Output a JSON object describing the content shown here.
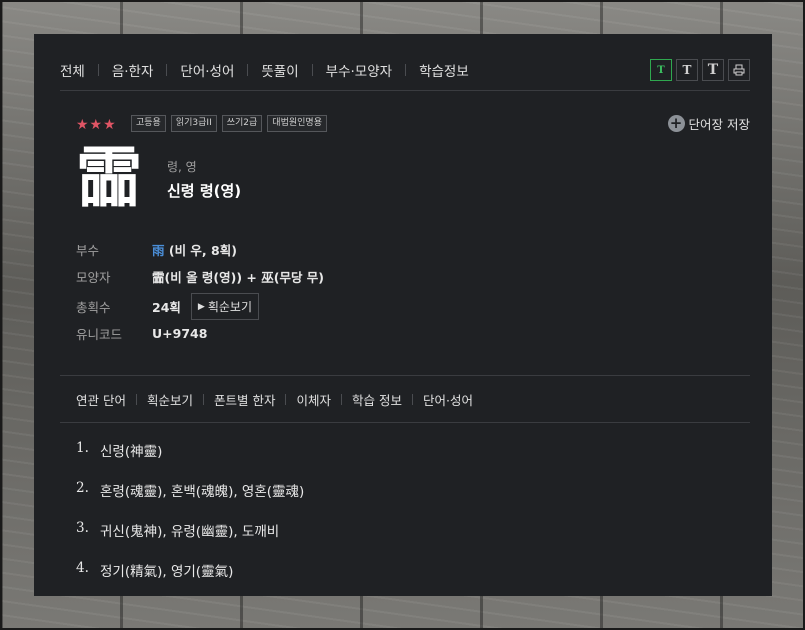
{
  "nav": {
    "items": [
      "전체",
      "음·한자",
      "단어·성어",
      "뜻풀이",
      "부수·모양자",
      "학습정보"
    ],
    "tools": [
      "T",
      "T",
      "T"
    ]
  },
  "entry": {
    "stars": "★★★",
    "tags": [
      "고등용",
      "읽기3급II",
      "쓰기2급",
      "대법원인명용"
    ],
    "save_label": "단어장 저장",
    "save_icon": "plus-circle",
    "hanja": "霝",
    "reading": "령, 영",
    "meaning": "신령 령(영)"
  },
  "info": {
    "radical_label": "부수",
    "radical_char": "雨",
    "radical_detail": " (비 우, 8획)",
    "shape_label": "모양자",
    "shape_value": "霝(비 올 령(영)) + 巫(무당 무)",
    "strokes_label": "총획수",
    "strokes_value": "24획",
    "stroke_order_button": "획순보기",
    "unicode_label": "유니코드",
    "unicode_value": "U+9748"
  },
  "subnav": {
    "items": [
      "연관 단어",
      "획순보기",
      "폰트별 한자",
      "이체자",
      "학습 정보",
      "단어·성어"
    ]
  },
  "words": [
    {
      "num": "1.",
      "text": "신령(神靈)"
    },
    {
      "num": "2.",
      "text": "혼령(魂靈), 혼백(魂魄), 영혼(靈魂)"
    },
    {
      "num": "3.",
      "text": "귀신(鬼神), 유령(幽靈), 도깨비"
    },
    {
      "num": "4.",
      "text": "정기(精氣), 영기(靈氣)"
    }
  ],
  "colors": {
    "panel": "#1f2124",
    "stars": "#e05565",
    "accent_green": "#2fa84f",
    "radical_blue": "#4a8ed8"
  }
}
